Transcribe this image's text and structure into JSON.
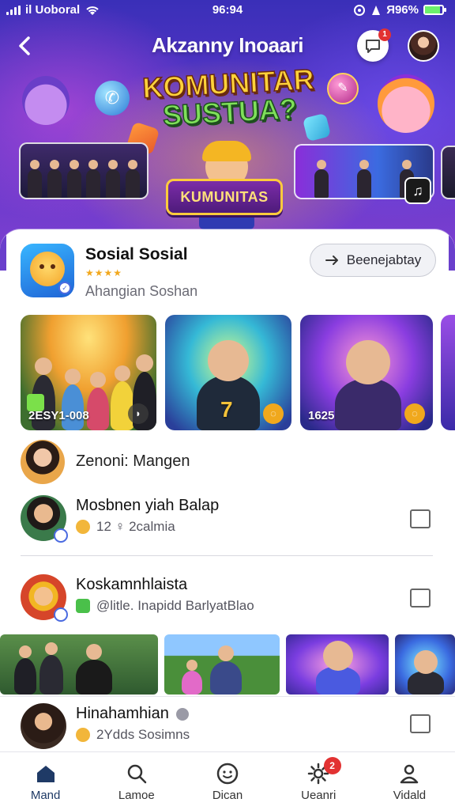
{
  "status_bar": {
    "carrier": "il Uoboral",
    "time": "96:94",
    "battery": "Я96%",
    "battery_level": 0.86
  },
  "header": {
    "title": "Akzanny Inoaari",
    "chat_badge": "1"
  },
  "hero": {
    "headline_line1": "KOMUNITAR",
    "headline_line2": "SUSTUA?",
    "sign_text": "KUMUNITAS",
    "tiktok_glyph": "♫"
  },
  "group": {
    "name": "Sosial Sosial",
    "stars": "★★★★",
    "subtitle": "Ahangian Soshan",
    "join_label": "Beenejabtay"
  },
  "tiles": [
    {
      "caption": "2ESY1-008",
      "pill": "◗"
    },
    {
      "caption": "7",
      "pill": "◌"
    },
    {
      "caption": "1625",
      "pill": "◌"
    }
  ],
  "section": {
    "label": "Zenoni: Mangen"
  },
  "rows": [
    {
      "title": "Mosbnen yiah  Balap",
      "subtitle": "12 ♀ 2calmia"
    },
    {
      "title": "Koskamnhlaista",
      "subtitle": "@litle. Inapidd BarlyatBlao"
    },
    {
      "title": "Hinahamhian",
      "subtitle": "2Ydds Sosimns"
    }
  ],
  "bottom_nav": [
    {
      "label": "Mand",
      "icon": "home-icon",
      "active": true
    },
    {
      "label": "Lamoe",
      "icon": "search-icon",
      "active": false
    },
    {
      "label": "Dican",
      "icon": "smiley-icon",
      "active": false
    },
    {
      "label": "Ueanri",
      "icon": "gear-icon",
      "active": false,
      "badge": "2"
    },
    {
      "label": "Vidald",
      "icon": "profile-icon",
      "active": false
    }
  ],
  "colors": {
    "hero_top": "#3a2fb8",
    "hero_bottom": "#7c3fd0",
    "accent_badge": "#e23232",
    "star": "#f2a81d"
  }
}
